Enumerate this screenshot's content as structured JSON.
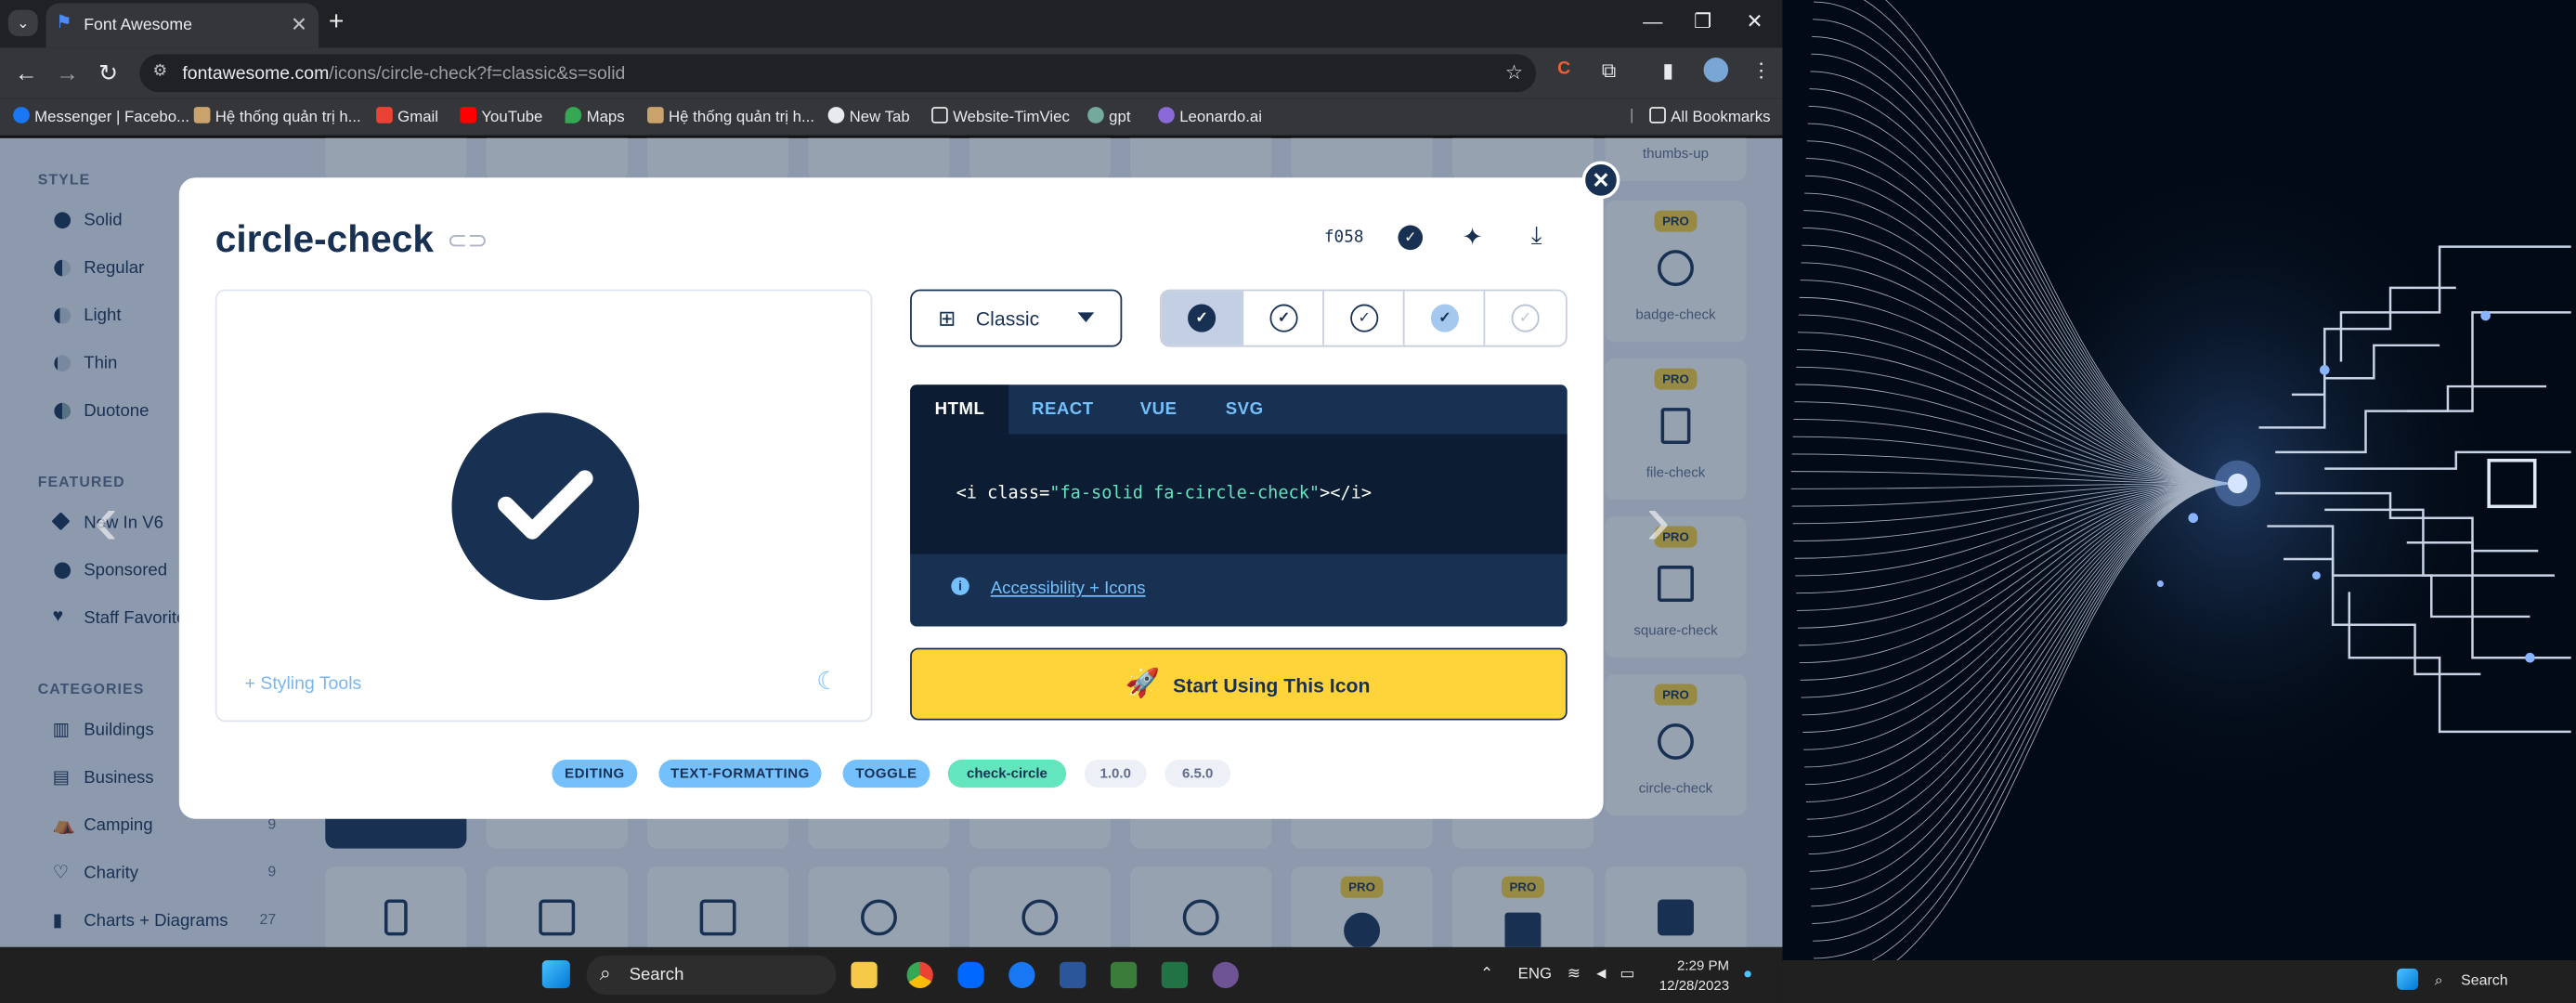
{
  "browser": {
    "tab_title": "Font Awesome",
    "url_host": "fontawesome.com",
    "url_path": "/icons/circle-check?f=classic&s=solid",
    "bookmarks": [
      "Messenger | Facebo...",
      "Hệ thống quản trị h...",
      "Gmail",
      "YouTube",
      "Maps",
      "Hệ thống quản trị h...",
      "New Tab",
      "Website-TimViec",
      "gpt",
      "Leonardo.ai"
    ],
    "all_bookmarks": "All Bookmarks"
  },
  "sidebar": {
    "style_heading": "STYLE",
    "styles": [
      "Solid",
      "Regular",
      "Light",
      "Thin",
      "Duotone"
    ],
    "featured_heading": "FEATURED",
    "featured": [
      "New In V6",
      "Sponsored",
      "Staff Favorites"
    ],
    "categories_heading": "CATEGORIES",
    "categories": [
      {
        "label": "Buildings",
        "count": ""
      },
      {
        "label": "Business",
        "count": ""
      },
      {
        "label": "Camping",
        "count": "9"
      },
      {
        "label": "Charity",
        "count": "9"
      },
      {
        "label": "Charts + Diagrams",
        "count": "27"
      }
    ]
  },
  "grid": {
    "top_label": "thumbs-up",
    "right_items": [
      "badge-check",
      "file-check",
      "square-check",
      "circle-check"
    ],
    "pro_badge": "PRO"
  },
  "modal": {
    "title": "circle-check",
    "unicode": "f058",
    "family_selected": "Classic",
    "code_tabs": [
      "HTML",
      "REACT",
      "VUE",
      "SVG"
    ],
    "code_prefix": "<i class=",
    "code_class": "\"fa-solid fa-circle-check\"",
    "code_suffix": "></i>",
    "accessibility_link": "Accessibility + Icons",
    "styling_tools": "+ Styling Tools",
    "cta": "Start Using This Icon",
    "tags": [
      "EDITING",
      "TEXT-FORMATTING",
      "TOGGLE",
      "check-circle",
      "1.0.0",
      "6.5.0"
    ]
  },
  "taskbar": {
    "search_placeholder": "Search",
    "lang": "ENG",
    "time": "2:29 PM",
    "date": "12/28/2023",
    "secondary_search": "Search"
  },
  "colors": {
    "navy": "#183153",
    "yellow": "#ffd43b",
    "light_blue": "#74c0fc",
    "mint": "#63e6be"
  }
}
